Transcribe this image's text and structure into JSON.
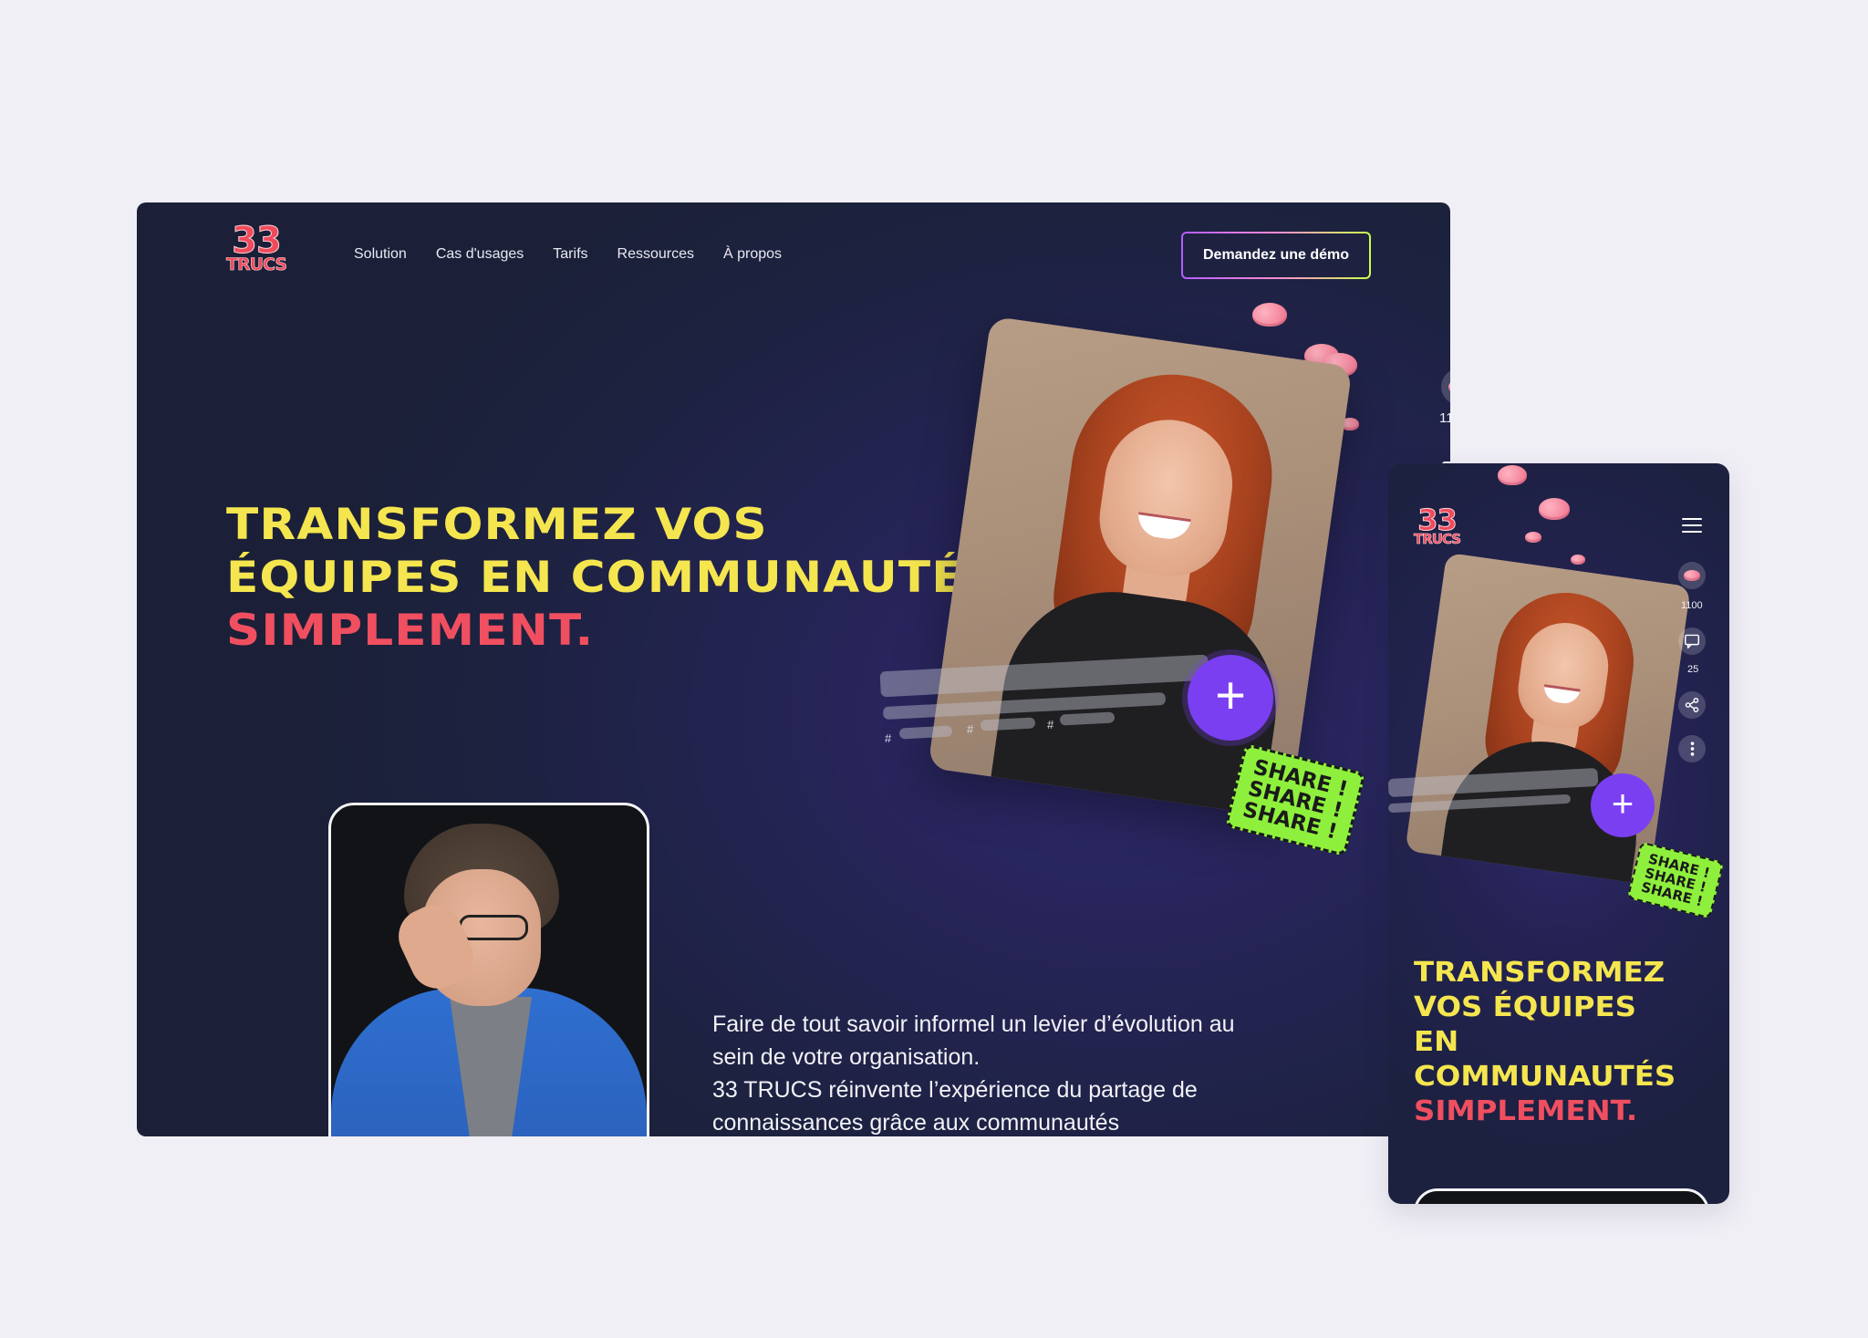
{
  "brand": {
    "logo_top": "33",
    "logo_bottom": "TRUCS"
  },
  "nav": {
    "items": [
      {
        "label": "Solution"
      },
      {
        "label": "Cas d'usages"
      },
      {
        "label": "Tarifs"
      },
      {
        "label": "Ressources"
      },
      {
        "label": "À propos"
      }
    ],
    "cta_label": "Demandez une démo"
  },
  "hero": {
    "headline_line1": "TRANSFORMEZ VOS",
    "headline_line2": "ÉQUIPES EN COMMUNAUTÉS",
    "headline_accent": "SIMPLEMENT.",
    "subtext_line1": "Faire de tout savoir informel un levier d’évolution au sein de votre organisation.",
    "subtext_line2": "33 TRUCS réinvente l’expérience du partage de connaissances grâce aux communautés"
  },
  "video": {
    "likes_count": "1100",
    "comments_count": "25",
    "hashtag_symbol": "#",
    "plus_label": "+",
    "sticker_text": "SHARE !"
  },
  "mobile": {
    "headline_lines": [
      "TRANSFORMEZ",
      "VOS ÉQUIPES",
      "EN",
      "COMMUNAUTÉS"
    ],
    "headline_accent": "SIMPLEMENT.",
    "likes_count": "1100",
    "comments_count": "25"
  },
  "colors": {
    "page_bg": "#f0eff6",
    "hero_bg": "#1d2240",
    "headline_yellow": "#f5e64f",
    "headline_red": "#f04f60",
    "plus_purple": "#7b3ff2",
    "sticker_green": "#8ef03c"
  },
  "icons": [
    "brain-icon",
    "comment-icon",
    "share-icon",
    "more-vertical-icon",
    "plus-icon",
    "hamburger-menu-icon"
  ]
}
